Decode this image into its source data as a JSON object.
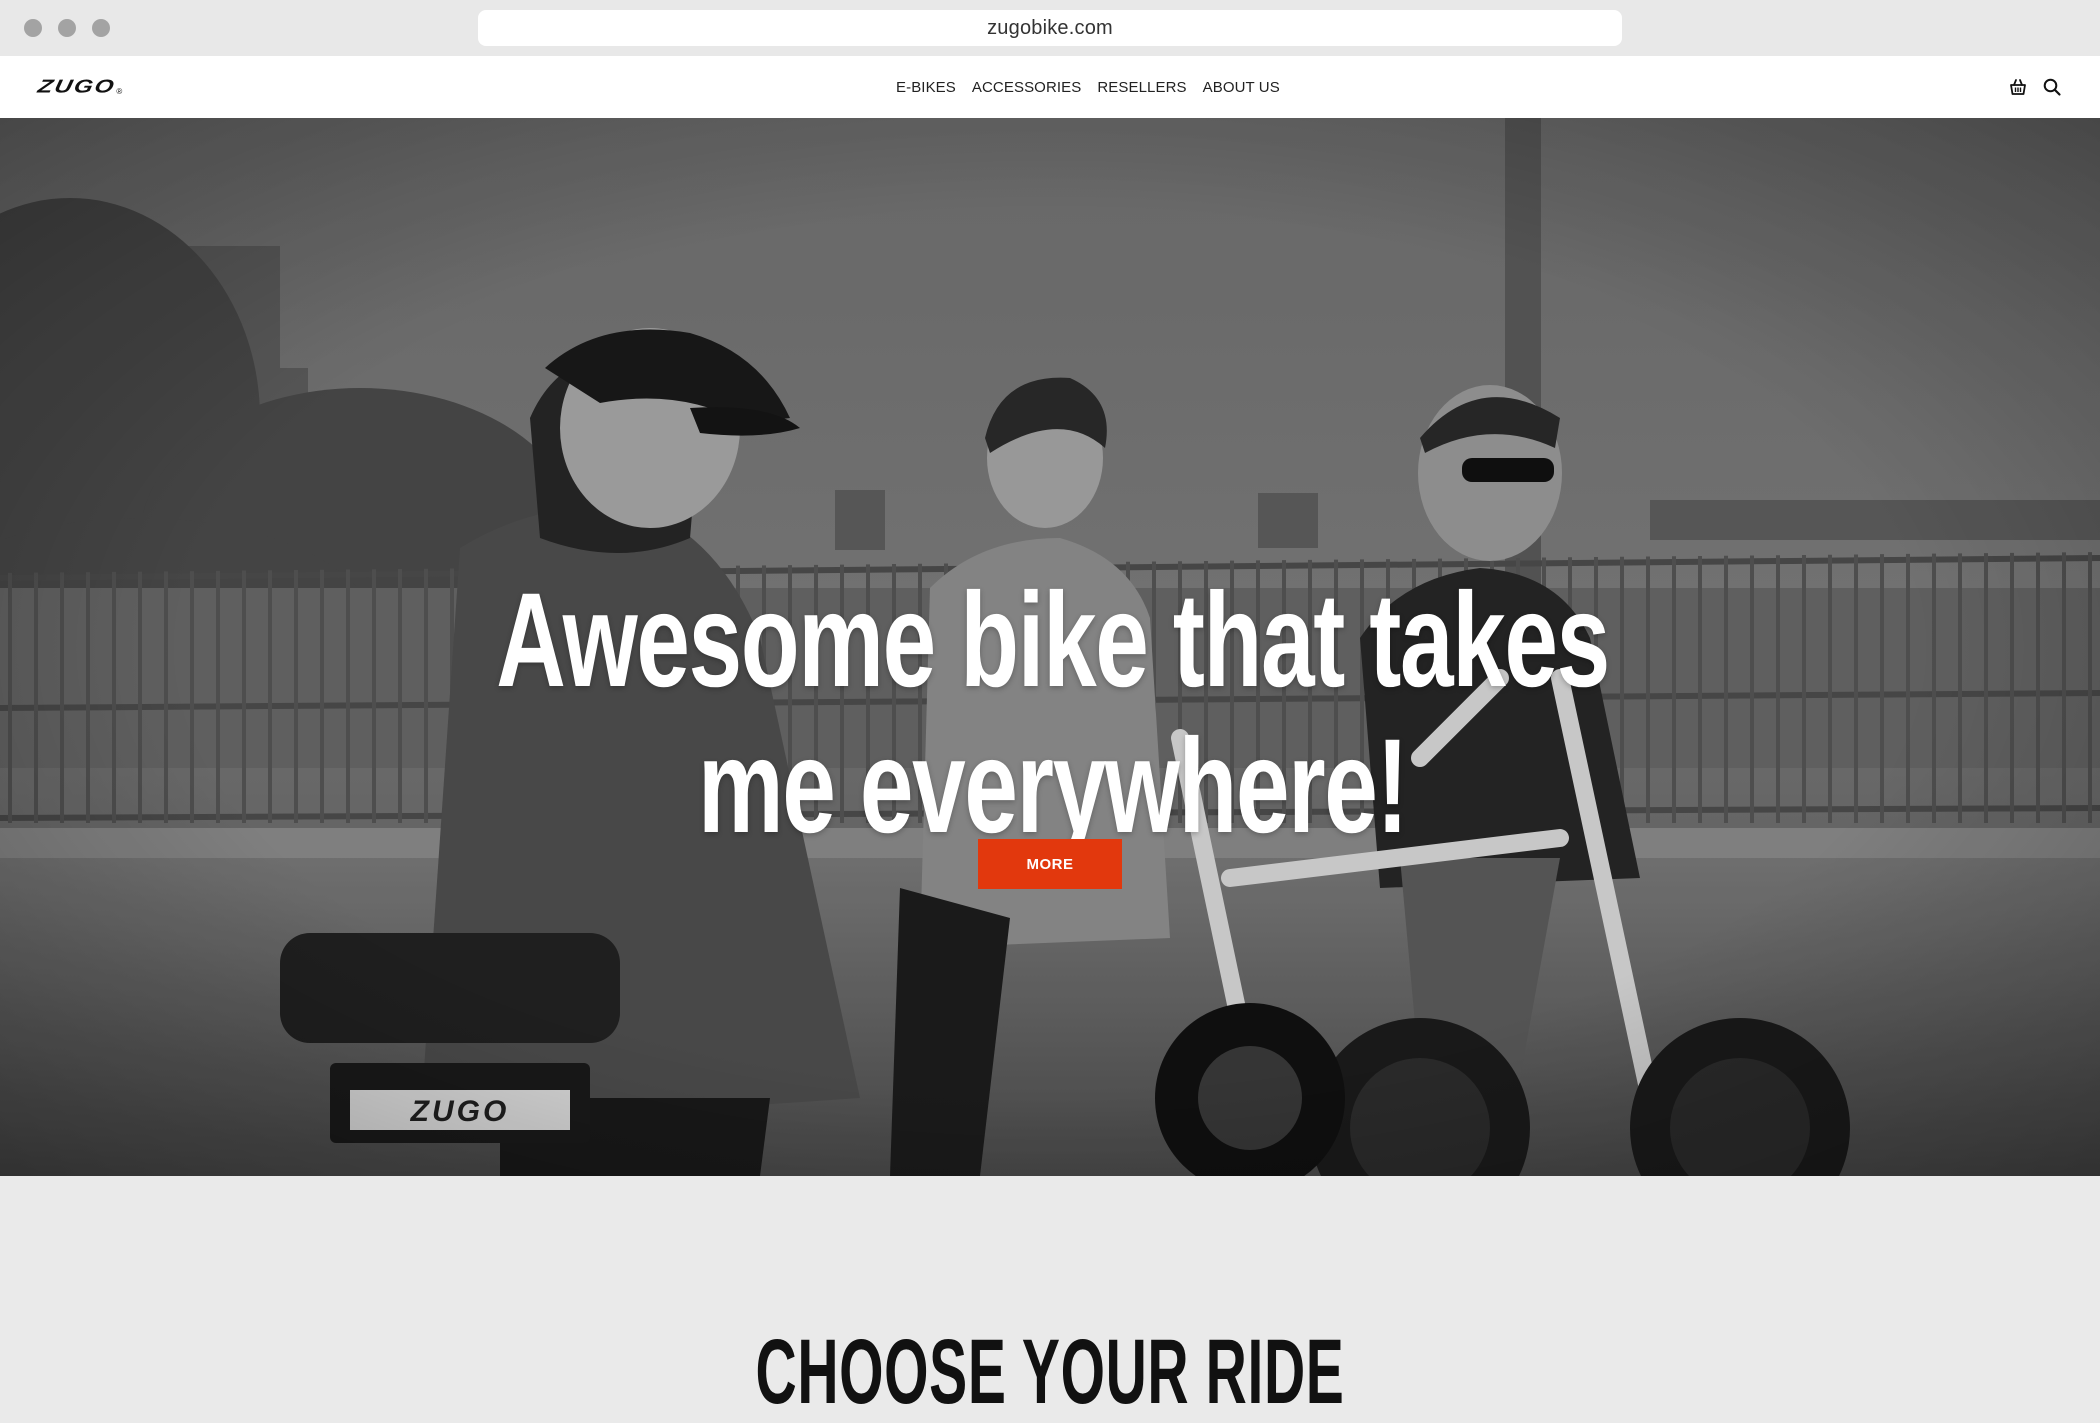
{
  "browser": {
    "url": "zugobike.com"
  },
  "header": {
    "logo_text": "ZUGO",
    "logo_mark": "®",
    "nav": [
      {
        "label": "E-BIKES"
      },
      {
        "label": "ACCESSORIES"
      },
      {
        "label": "RESELLERS"
      },
      {
        "label": "ABOUT US"
      }
    ],
    "icons": [
      "basket-icon",
      "search-icon"
    ]
  },
  "hero": {
    "title_line1": "Awesome bike that takes",
    "title_line2": "me everywhere!",
    "cta_label": "MORE",
    "cta_color": "#e2380d",
    "image_style": "grayscale photo of three people on e-bikes on a bridge",
    "bike_label": "ZUGO"
  },
  "section": {
    "title": "CHOOSE YOUR RIDE"
  },
  "colors": {
    "accent": "#e2380d",
    "chrome_bg": "#e8e8e8",
    "section_bg": "#eaeaea"
  }
}
